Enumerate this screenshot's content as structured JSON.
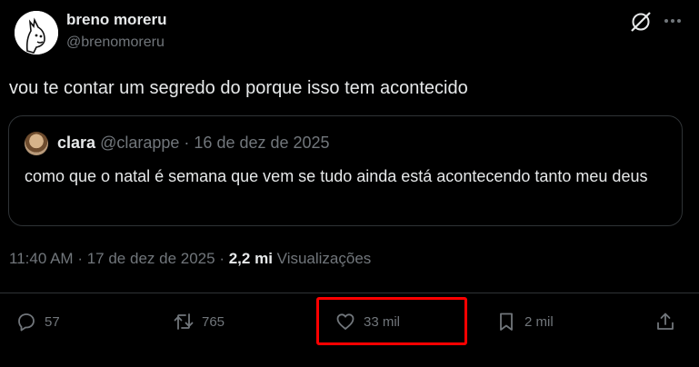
{
  "author": {
    "name": "breno moreru",
    "handle": "@brenomoreru"
  },
  "tweet": {
    "text": "vou te contar um segredo do porque isso tem acontecido"
  },
  "quote": {
    "name": "clara",
    "handle": "@clarappe",
    "separator": "·",
    "date": "16 de dez de 2025",
    "text": "como que o natal é semana que vem se tudo ainda está acontecendo tanto meu deus"
  },
  "meta": {
    "time": "11:40 AM",
    "separator": "·",
    "date": "17 de dez de 2025",
    "separator2": "·",
    "views_count": "2,2 mi",
    "views_label": "Visualizações"
  },
  "actions": {
    "reply_count": "57",
    "repost_count": "765",
    "like_count": "33 mil",
    "bookmark_count": "2 mil"
  },
  "colors": {
    "background": "#000000",
    "text": "#e7e9ea",
    "secondary": "#71767b",
    "border": "#2f3336",
    "highlight": "#ff0000"
  }
}
